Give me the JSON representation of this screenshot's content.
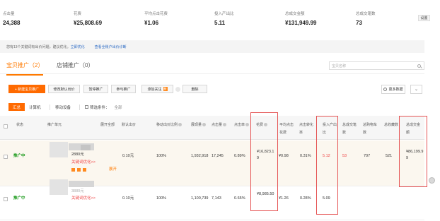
{
  "stats": [
    {
      "label": "点击量",
      "value": "24,388"
    },
    {
      "label": "花费",
      "value": "¥25,808.69"
    },
    {
      "label": "平均点击花费",
      "value": "¥1.06"
    },
    {
      "label": "投入产出比",
      "value": "5.11"
    },
    {
      "label": "总成交金额",
      "value": "¥131,949.99"
    },
    {
      "label": "总成交笔数",
      "value": "73"
    }
  ],
  "settings_label": "设置",
  "notice": {
    "text": "您有13个关键词有出价问题，建议优化。",
    "link1": "立即优化",
    "link2": "查看全账户出价诊断"
  },
  "tabs": {
    "active": "宝贝推广（2）",
    "inactive": "店铺推广（0）"
  },
  "search": {
    "placeholder": "宝贝名称"
  },
  "toolbar": {
    "new_button": "+ 新建宝贝推广",
    "batch_bid": "修改默认出价",
    "pause": "暂停推广",
    "resume": "参与推广",
    "add_follow": "添加关注",
    "add_follow_badge": "新",
    "delete": "删除",
    "more_data": "更多数据"
  },
  "filter": {
    "summary": "汇总",
    "pc": "计算机",
    "mobile": "移动设备",
    "conditions": "筛选条件：",
    "conditions_value": "全部"
  },
  "table": {
    "headers": {
      "status": "状态",
      "item": "推广单元",
      "promo_status": "展开全部",
      "default_bid": "默认出价",
      "mobile_ratio": "移动出价比例",
      "impressions": "展现量",
      "clicks": "点击量",
      "ctr": "点击率",
      "cost": "花费",
      "avg_cpc": "平均点击花费",
      "conv_rate": "点击转化率",
      "roi": "投入产出比",
      "orders": "总成交笔数",
      "carts": "总购物车数",
      "favorites": "总收藏数",
      "gmv": "总成交金额"
    },
    "rows": [
      {
        "status": "推广中",
        "price": "2880元",
        "link": "关键词优化>>",
        "expand": "展开",
        "default_bid": "0.10元",
        "mobile_ratio": "100%",
        "impressions": "1,932,918",
        "clicks": "17,245",
        "ctr": "0.89%",
        "cost": "¥16,823.19",
        "avg_cpc": "¥0.98",
        "conv_rate": "0.31%",
        "roi": "5.12",
        "orders": "53",
        "carts": "707",
        "favorites": "521",
        "gmv": "¥86,199.99"
      },
      {
        "status": "推广中",
        "price": "3880元",
        "link": "关键词优化>>",
        "default_bid": "0.10元",
        "mobile_ratio": "100%",
        "impressions": "1,100,739",
        "clicks": "7,143",
        "ctr": "0.65%",
        "cost": "¥8,985.50",
        "avg_cpc": "¥1.26",
        "conv_rate": "0.28%",
        "roi": "5.09"
      }
    ]
  },
  "colors": {
    "accent": "#ff6a00",
    "status_green": "#1a9a1a",
    "highlight_red": "#e55353",
    "link_blue": "#2b6ac4"
  }
}
